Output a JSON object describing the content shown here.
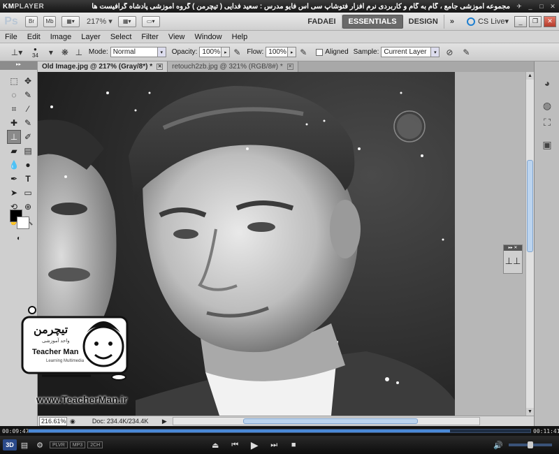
{
  "player": {
    "name_a": "KM",
    "name_b": "PLAYER",
    "caption": "مجموعه آموزشی جامع ، گام به گام و کاربردی نرم افزار فتوشاپ سی اس فایو   مدرس : سعید فدایی ( تیچرمن ) گروه آموزشی پادشاه گرافیست ها",
    "time_elapsed": "00:09:47",
    "time_total": "00:11:41",
    "progress_fraction": 0.84,
    "chip_1": "PLVR",
    "chip_2": "MP3",
    "chip_3": "2CH",
    "btn_3d": "3D",
    "volume_fraction": 0.5
  },
  "appbar": {
    "logo": "Ps",
    "bridge": "Br",
    "minibridge": "Mb",
    "zoom": "217%",
    "workspaces": [
      "FADAEI",
      "ESSENTIALS",
      "DESIGN"
    ],
    "active_workspace": "ESSENTIALS",
    "cslive": "CS Live"
  },
  "menu": [
    "File",
    "Edit",
    "Image",
    "Layer",
    "Select",
    "Filter",
    "View",
    "Window",
    "Help"
  ],
  "options": {
    "brush_size": "34",
    "mode_label": "Mode:",
    "mode_value": "Normal",
    "opacity_label": "Opacity:",
    "opacity_value": "100%",
    "flow_label": "Flow:",
    "flow_value": "100%",
    "aligned_label": "Aligned",
    "sample_label": "Sample:",
    "sample_value": "Current Layer"
  },
  "tabs": [
    {
      "label": "Old Image.jpg @ 217% (Gray/8*) *",
      "active": true
    },
    {
      "label": "retouch2zb.jpg @ 321% (RGB/8#) *",
      "active": false
    }
  ],
  "status": {
    "zoom": "216.61%",
    "doc": "Doc: 234.4K/234.4K"
  },
  "overlay": {
    "logo_fa": "تیچرمن",
    "logo_sub": "واحد آموزشی",
    "logo_en": "Teacher Man",
    "logo_tag": "Learning Multimedia",
    "url": "www.TeacherMan.ir"
  }
}
